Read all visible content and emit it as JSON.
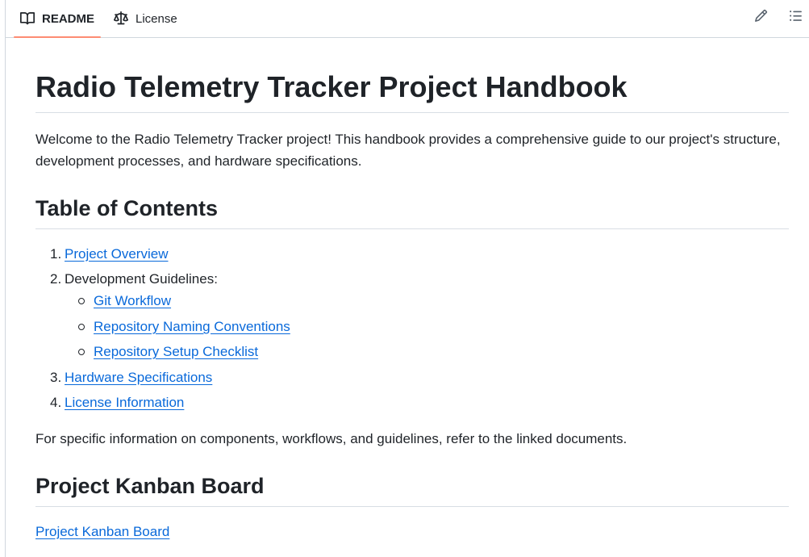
{
  "tabs": {
    "readme": "README",
    "license": "License"
  },
  "toolbar": {
    "edit_icon": "pencil-icon",
    "outline_icon": "list-unordered-icon"
  },
  "doc": {
    "title": "Radio Telemetry Tracker Project Handbook",
    "intro": "Welcome to the Radio Telemetry Tracker project! This handbook provides a comprehensive guide to our project's structure, development processes, and hardware specifications.",
    "toc_heading": "Table of Contents",
    "toc": [
      {
        "num": "1.",
        "label": "Project Overview",
        "link": true
      },
      {
        "num": "2.",
        "label": "Development Guidelines:",
        "link": false
      },
      {
        "num": "3.",
        "label": "Hardware Specifications",
        "link": true
      },
      {
        "num": "4.",
        "label": "License Information",
        "link": true
      }
    ],
    "toc_sub": [
      {
        "label": "Git Workflow"
      },
      {
        "label": "Repository Naming Conventions"
      },
      {
        "label": "Repository Setup Checklist"
      }
    ],
    "specific_text": "For specific information on components, workflows, and guidelines, refer to the linked documents.",
    "kanban_heading": "Project Kanban Board",
    "kanban_link": "Project Kanban Board"
  },
  "colors": {
    "link": "#0969da",
    "tab_underline": "#fd8c73",
    "text": "#1f2328",
    "border": "#d0d7de"
  }
}
